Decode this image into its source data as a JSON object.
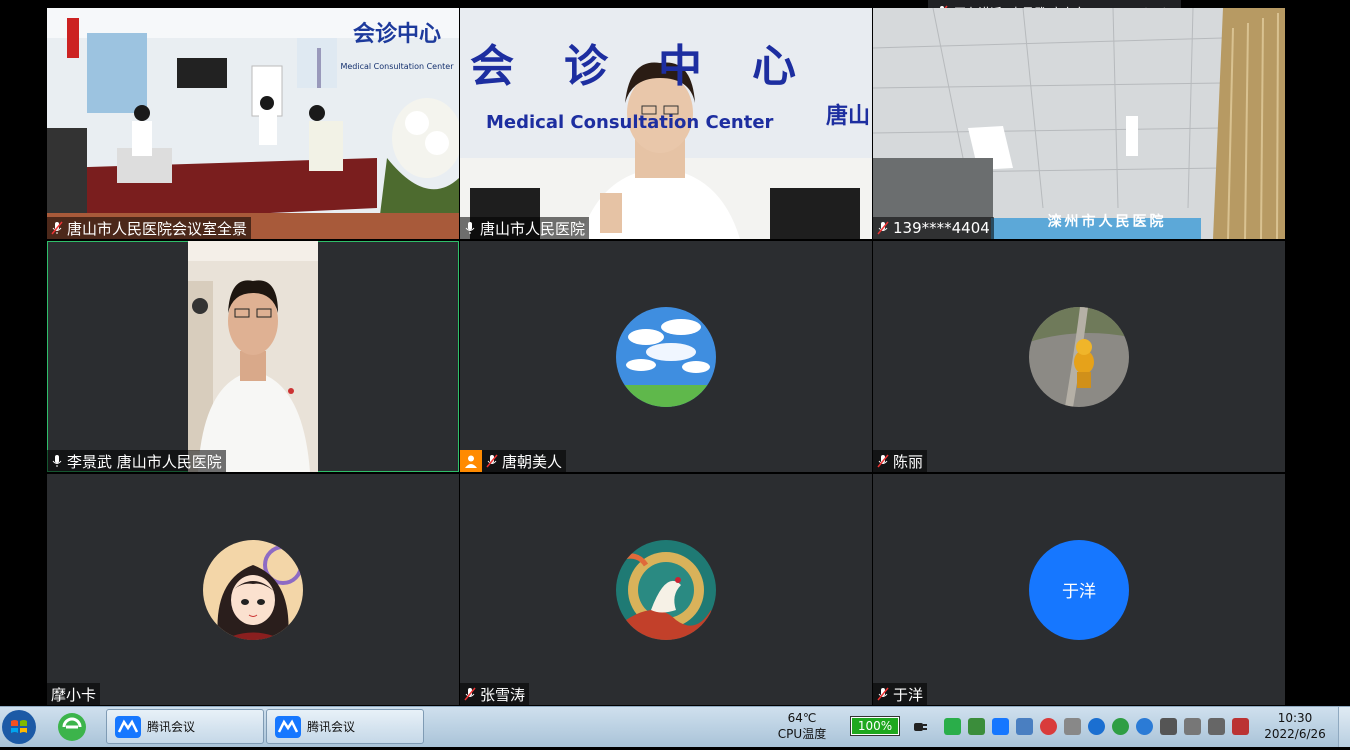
{
  "speaking": {
    "text": "正在讲话: 李景武 唐山市..."
  },
  "tiles": [
    {
      "name": "唐山市人民医院会议室全景",
      "type": "video-room"
    },
    {
      "name": "唐山市人民医院",
      "type": "video-doctor",
      "wall_cn": "会诊中心",
      "wall_en": "Medical Consultation Center",
      "wall_right": "唐山"
    },
    {
      "name": "139****4404",
      "type": "video-ceiling",
      "banner": "滦州市人民医院"
    },
    {
      "name": "李景武 唐山市人民医院",
      "type": "video-person"
    },
    {
      "name": "唐朝美人",
      "type": "avatar-sky"
    },
    {
      "name": "陈丽",
      "type": "avatar-road"
    },
    {
      "name": "摩小卡",
      "type": "avatar-girl"
    },
    {
      "name": "张雪涛",
      "type": "avatar-art"
    },
    {
      "name": "于洋",
      "type": "avatar-text",
      "avatar_text": "于洋"
    }
  ],
  "room_sign": {
    "cn": "会诊中心",
    "en": "Medical Consultation Center"
  },
  "taskbar": {
    "buttons": [
      {
        "label": "腾讯会议"
      },
      {
        "label": "腾讯会议"
      }
    ],
    "cpu_temp": "64℃",
    "cpu_label": "CPU温度",
    "battery": "100%",
    "battery_level": 1.0,
    "time": "10:30",
    "date": "2022/6/26"
  },
  "colors": {
    "tile_bg": "#2b2d30",
    "active_border": "#2fbf6a",
    "avatar_blue": "#1677ff",
    "badge_orange": "#ff8a00"
  }
}
